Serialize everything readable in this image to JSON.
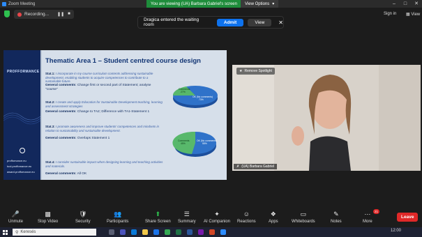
{
  "window": {
    "title": "Zoom Meeting"
  },
  "share_banner": "You are viewing (UA) Barbara Gabriel's screen",
  "view_options": "View Options",
  "recording": {
    "label": "Recording..."
  },
  "top_right": {
    "sign_in": "Sign in",
    "view": "View"
  },
  "waiting_room": {
    "message": "Dragica entered the waiting room",
    "admit": "Admit",
    "view": "View"
  },
  "slide": {
    "brand": "PROFFORMANCE",
    "links": [
      "proffomance.eu",
      "tool.proffomance.eu",
      "award.proffomance.eu"
    ],
    "title": "Thematic Area 1 – Student centred course design",
    "stats": [
      {
        "label": "Stat.1:",
        "text": "I incorporate in my course curriculum contents addressing sustainable development, enabling students to acquire competences to contribute to a sustainable future.",
        "gc_label": "General comments",
        "gc_text": ": Change first or second part of Statement; analyse \"course\""
      },
      {
        "label": "Stat.2:",
        "text": "I create and apply Education for Sustainable Development teaching, learning and assessment strategies",
        "gc_label": "General comments",
        "gc_text": ": Change to TA2; Difference with TA1-Statement 1"
      },
      {
        "label": "Stat.3:",
        "text": "I promote awareness and improve students' competences and mindsets in relation to sustainability and sustainable development.",
        "gc_label": "General comments",
        "gc_text": ": Overlaps Statement 1"
      },
      {
        "label": "Stat.4:",
        "text": "I consider sustainable impact when designing learning and teaching activities and materials.",
        "gc_label": "General comments",
        "gc_text": ": All OK"
      }
    ],
    "pie1": {
      "a_label": "Comments",
      "a_value": "27%",
      "b_label": "OK (No comments)",
      "b_value": "73%"
    },
    "pie2": {
      "a_label": "Comments",
      "a_value": "45%",
      "b_label": "OK (No comments)",
      "b_value": "55%"
    }
  },
  "video": {
    "spotlight": "Remove Spotlight",
    "name": "(UA) Barbara Gabriel"
  },
  "toolbar": [
    {
      "label": "Unmute",
      "icon": "mic-off-icon"
    },
    {
      "label": "Stop Video",
      "icon": "video-icon"
    },
    {
      "label": "Security",
      "icon": "shield-icon"
    },
    {
      "label": "Participants",
      "icon": "participants-icon",
      "count": "8"
    },
    {
      "label": "Share Screen",
      "icon": "share-icon"
    },
    {
      "label": "Summary",
      "icon": "summary-icon"
    },
    {
      "label": "AI Companion",
      "icon": "ai-icon"
    },
    {
      "label": "Reactions",
      "icon": "reactions-icon"
    },
    {
      "label": "Apps",
      "icon": "apps-icon"
    },
    {
      "label": "Whiteboards",
      "icon": "whiteboard-icon"
    },
    {
      "label": "Notes",
      "icon": "notes-icon"
    },
    {
      "label": "More",
      "icon": "more-icon"
    }
  ],
  "more_badge": "21",
  "leave": "Leave",
  "taskbar": {
    "search": "Keresés",
    "time": "12:00"
  },
  "colors": {
    "accent": "#0e72ed",
    "share_green": "#1e8d3b",
    "leave_red": "#e02828",
    "slide_navy": "#12285c"
  }
}
